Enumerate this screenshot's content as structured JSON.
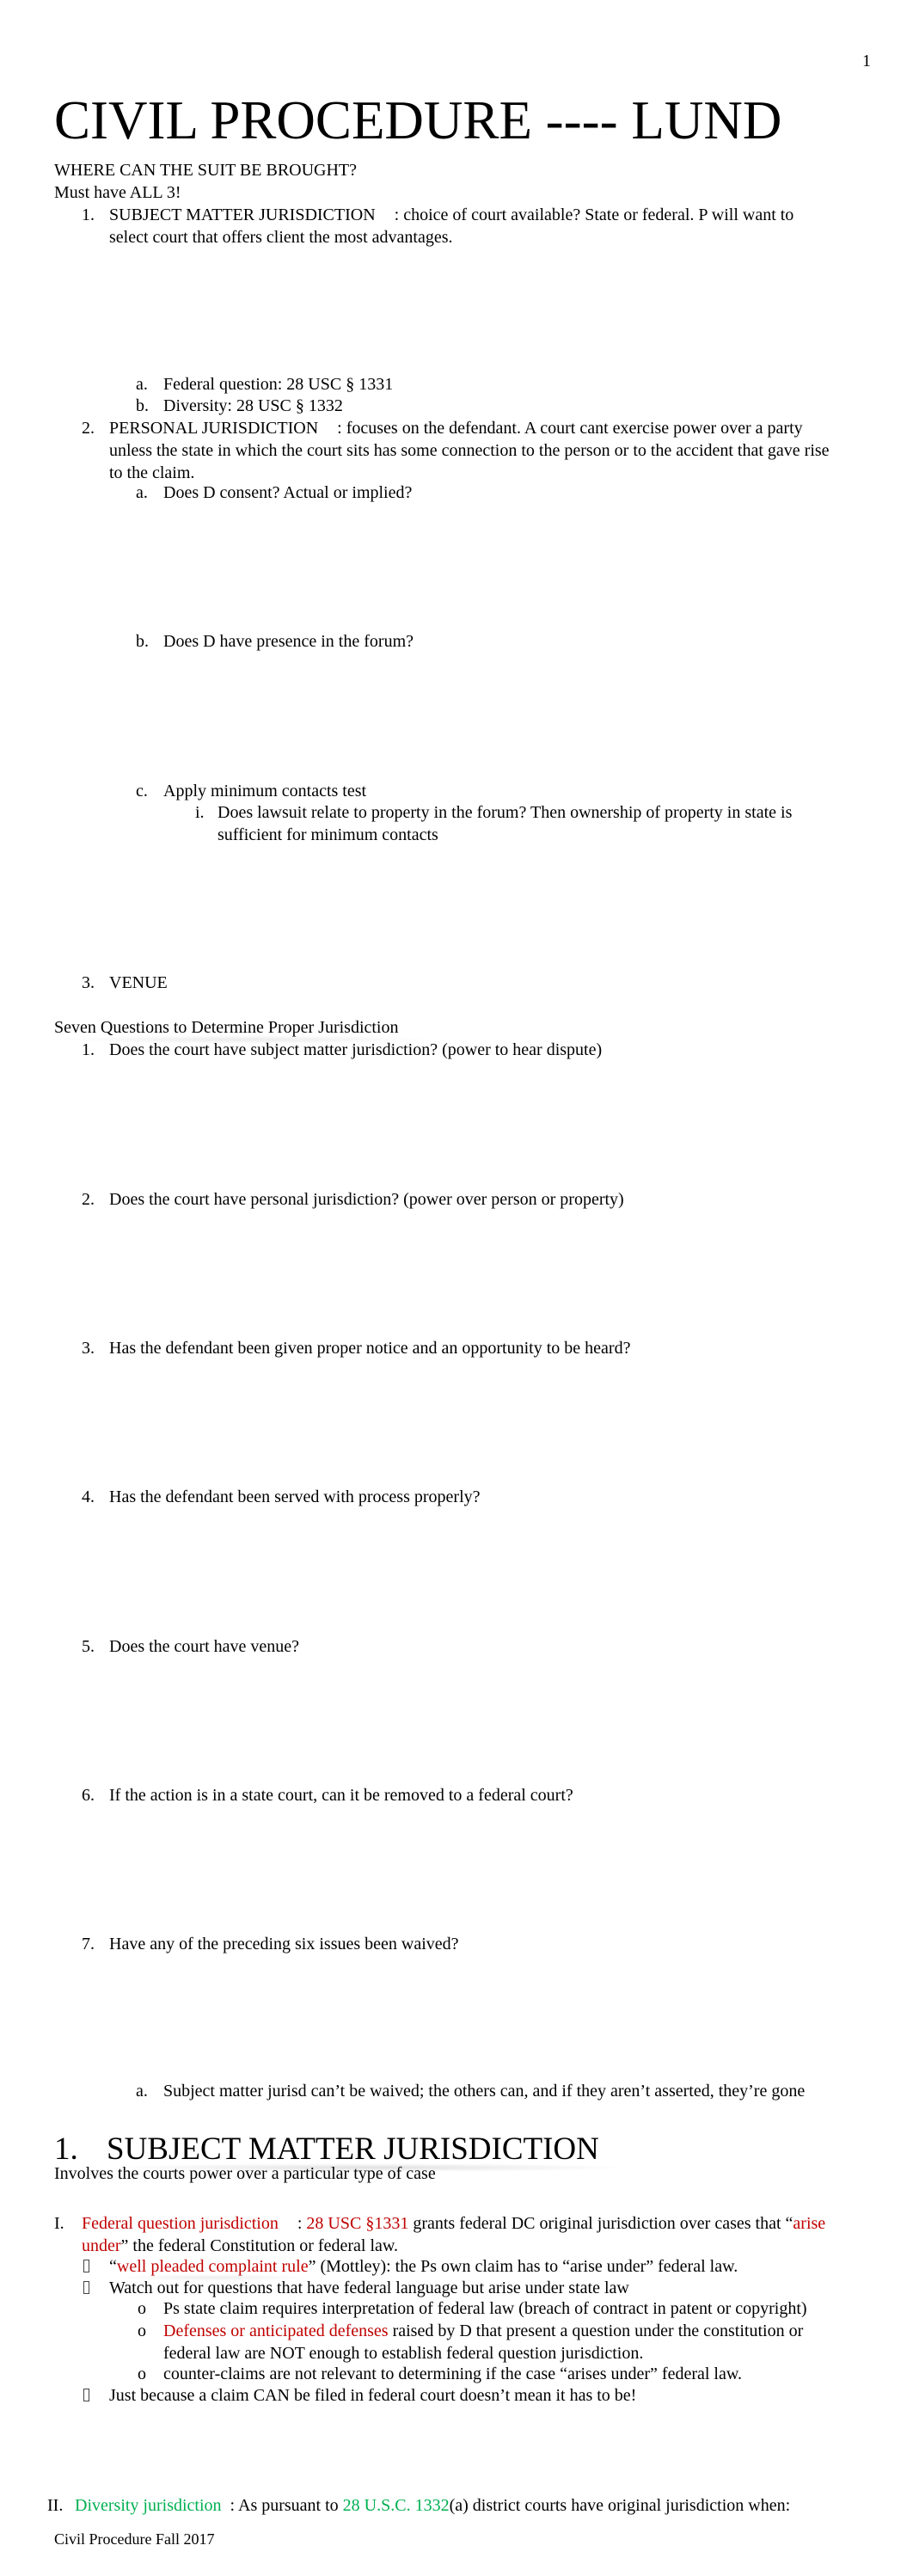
{
  "page": {
    "number": "1",
    "footer": "Civil Procedure Fall 2017"
  },
  "title": "CIVIL PROCEDURE ---- LUND",
  "intro": {
    "heading": "WHERE CAN THE SUIT BE BROUGHT?",
    "subheading": "Must have ALL 3!"
  },
  "requirements": [
    {
      "num": "1.",
      "label": "SUBJECT MATTER JURISDICTION",
      "text_line1": ": choice of court available? State or federal. P will want to",
      "text_line2": "select court that offers client the most advantages.",
      "subitems": [
        {
          "letter": "a.",
          "text": "Federal question: 28 USC § 1331"
        },
        {
          "letter": "b.",
          "text": "Diversity: 28 USC § 1332"
        }
      ]
    },
    {
      "num": "2.",
      "label": "PERSONAL JURISDICTION",
      "text_line1": ": focuses on the defendant. A court cant exercise power over a party",
      "text_line2": "unless the state in which the court sits has some connection to the person or to the accident that gave rise",
      "text_line3": "to the claim.",
      "subitems": [
        {
          "letter": "a.",
          "text": "Does D consent? Actual or implied?"
        },
        {
          "letter": "b.",
          "text": "Does D have presence in the forum?"
        },
        {
          "letter": "c.",
          "text": "Apply minimum contacts test",
          "subsub": {
            "roman": "i.",
            "line1": "Does lawsuit relate to property in the forum? Then ownership of property in state is",
            "line2": "sufficient for minimum contacts"
          }
        }
      ]
    },
    {
      "num": "3.",
      "label": "VENUE"
    }
  ],
  "seven_questions": {
    "heading": "Seven Questions to Determine Proper Jurisdiction",
    "items": [
      {
        "num": "1.",
        "text": "Does the court have subject matter jurisdiction? (power to hear dispute)"
      },
      {
        "num": "2.",
        "text": "Does the court have personal jurisdiction? (power over person or property)"
      },
      {
        "num": "3.",
        "text": "Has the defendant been given proper notice and an opportunity to be heard?"
      },
      {
        "num": "4.",
        "text": "Has the defendant been served with process properly?"
      },
      {
        "num": "5.",
        "text": "Does the court have venue?"
      },
      {
        "num": "6.",
        "text": "If the action is in a state court, can it be removed to a federal court?"
      },
      {
        "num": "7.",
        "text": "Have any of the preceding six issues been waived?"
      }
    ],
    "note": {
      "letter": "a.",
      "text": "Subject matter jurisd can’t be waived; the others can, and if they aren’t asserted, they’re gone"
    }
  },
  "smj_section": {
    "num": "1.",
    "heading": "SUBJECT MATTER JURISDICTION",
    "intro": "Involves the courts power over a particular type of case",
    "federal_question": {
      "roman": "I.",
      "label": "Federal question jurisdiction",
      "colon": ": ",
      "statute": "28 USC §1331",
      "text_a": " grants federal DC original jurisdiction over cases that “",
      "arise": "arise",
      "under": "under",
      "text_b": "” the federal Constitution or federal law.",
      "bullets": [
        {
          "open_quote": "“",
          "red": "well pleaded complaint rule",
          "text": "” (Mottley): the Ps own claim has to “arise under” federal law."
        },
        {
          "text": "Watch out for questions that have federal language but arise under state law",
          "subbullets": [
            {
              "marker": "o",
              "text": "Ps state claim requires interpretation of federal law (breach of contract in patent or copyright)"
            },
            {
              "marker": "o",
              "red": "Defenses or anticipated defenses",
              "text_line1": " raised by D that present a question under the constitution or",
              "text_line2": "federal law are NOT enough to establish federal question jurisdiction."
            },
            {
              "marker": "o",
              "text": "counter-claims are not relevant to determining if the case “arises under” federal law."
            }
          ]
        },
        {
          "text": "Just because a claim CAN be filed in federal court doesn’t mean it has to be!"
        }
      ]
    },
    "diversity": {
      "roman": "II.",
      "label": "Diversity jurisdiction",
      "colon": ": As pursuant to ",
      "statute": "28 U.S.C. 1332",
      "text": "(a) district courts have original jurisdiction when:"
    }
  },
  "colors": {
    "red_emphasis": "#c00000",
    "green_emphasis": "#00b050",
    "text": "#000000"
  }
}
